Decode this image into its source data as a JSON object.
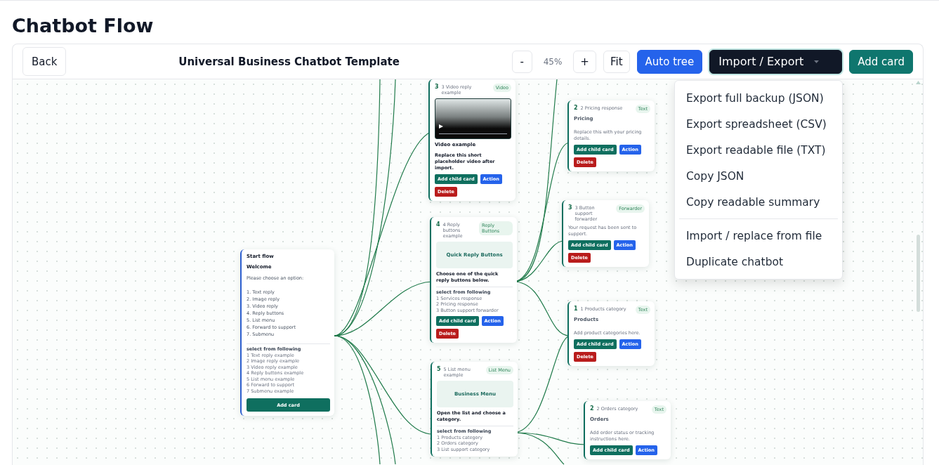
{
  "page": {
    "title": "Chatbot Flow"
  },
  "toolbar": {
    "back": "Back",
    "title": "Universal Business Chatbot Template",
    "zoom_out": "-",
    "zoom": "45%",
    "zoom_in": "+",
    "fit": "Fit",
    "auto_tree": "Auto tree",
    "import_export": {
      "label": "Import / Export",
      "expanded": true
    },
    "add_card": "Add card"
  },
  "menu": {
    "groups": [
      {
        "items": [
          "Export full backup (JSON)",
          "Export spreadsheet (CSV)",
          "Export readable file (TXT)",
          "Copy JSON",
          "Copy readable summary"
        ]
      },
      {
        "items": [
          "Import / replace from file",
          "Duplicate chatbot"
        ]
      }
    ]
  },
  "start_card": {
    "title": "Start flow",
    "heading": "Welcome",
    "intro": "Please choose an option:",
    "lines": [
      "1. Text reply",
      "2. Image reply",
      "3. Video reply",
      "4. Reply buttons",
      "5. List menu",
      "6. Forward to support",
      "7. Submenu"
    ],
    "options_label": "select from following",
    "options": [
      "1 Text reply example",
      "2 Image reply example",
      "3 Video reply example",
      "4 Reply buttons example",
      "5 List menu example",
      "6 Forward to support",
      "7 Submenu example"
    ],
    "button": "Add card"
  },
  "cards": [
    {
      "number": "3",
      "name": "3 Video reply example",
      "badge": "Video",
      "kind": "video",
      "heading": "Video example",
      "body": "Replace this short placeholder video after import.",
      "buttons": [
        {
          "label": "Add child card",
          "kind": "add"
        },
        {
          "label": "Action",
          "kind": "action"
        },
        {
          "label": "Delete",
          "kind": "delete"
        }
      ]
    },
    {
      "number": "4",
      "name": "4 Reply buttons example",
      "badge": "Reply Buttons",
      "kind": "banner",
      "banner": "Quick Reply Buttons",
      "body": "Choose one of the quick reply buttons below.",
      "options_label": "select from following",
      "options": [
        "1 Services response",
        "2 Pricing response",
        "3 Button support forwarder"
      ],
      "buttons": [
        {
          "label": "Add child card",
          "kind": "add"
        },
        {
          "label": "Action",
          "kind": "action"
        },
        {
          "label": "Delete",
          "kind": "delete"
        }
      ]
    },
    {
      "number": "5",
      "name": "5 List menu example",
      "badge": "List Menu",
      "kind": "banner",
      "banner": "Business Menu",
      "body": "Open the list and choose a category.",
      "options_label": "select from following",
      "options": [
        "1 Products category",
        "2 Orders category",
        "3 List support category"
      ]
    },
    {
      "number": "2",
      "name": "2 Pricing response",
      "badge": "Text",
      "kind": "text",
      "heading": "Pricing",
      "body": "Replace this with your pricing details.",
      "buttons": [
        {
          "label": "Add child card",
          "kind": "add"
        },
        {
          "label": "Action",
          "kind": "action"
        },
        {
          "label": "Delete",
          "kind": "delete"
        }
      ]
    },
    {
      "number": "3",
      "name": "3 Button support forwarder",
      "badge": "Forwarder",
      "kind": "text",
      "body": "Your request has been sent to support.",
      "buttons": [
        {
          "label": "Add child card",
          "kind": "add"
        },
        {
          "label": "Action",
          "kind": "action"
        },
        {
          "label": "Delete",
          "kind": "delete"
        }
      ]
    },
    {
      "number": "1",
      "name": "1 Products category",
      "badge": "Text",
      "kind": "text",
      "heading": "Products",
      "body": "Add product categories here.",
      "buttons": [
        {
          "label": "Add child card",
          "kind": "add"
        },
        {
          "label": "Action",
          "kind": "action"
        },
        {
          "label": "Delete",
          "kind": "delete"
        }
      ]
    },
    {
      "number": "2",
      "name": "2 Orders category",
      "badge": "Text",
      "kind": "text",
      "heading": "Orders",
      "body": "Add order status or tracking instructions here.",
      "buttons": [
        {
          "label": "Add child card",
          "kind": "add"
        },
        {
          "label": "Action",
          "kind": "action"
        }
      ]
    }
  ]
}
